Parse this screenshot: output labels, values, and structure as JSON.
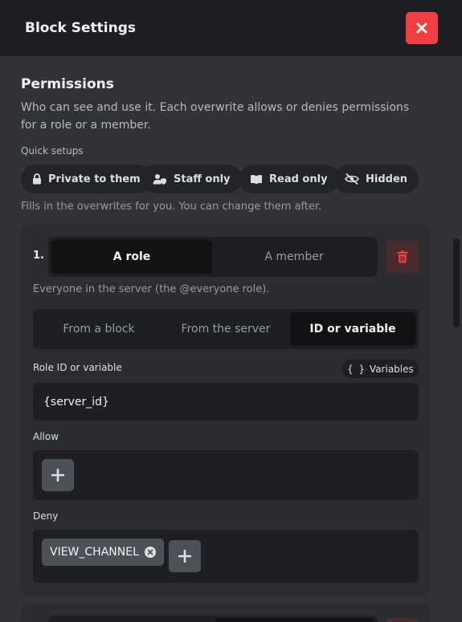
{
  "header": {
    "title": "Block Settings"
  },
  "permissions": {
    "title": "Permissions",
    "description": "Who can see and use it. Each overwrite allows or denies permissions for a role or a member.",
    "quick_setups_label": "Quick setups",
    "quick_setups": [
      {
        "label": "Private to them",
        "icon": "lock-icon"
      },
      {
        "label": "Staff only",
        "icon": "user-shield-icon"
      },
      {
        "label": "Read only",
        "icon": "book-icon"
      },
      {
        "label": "Hidden",
        "icon": "eye-off-icon"
      }
    ],
    "hint": "Fills in the overwrites for you. You can change them after."
  },
  "overwrite": {
    "number": "1.",
    "target_options": [
      "A role",
      "A member"
    ],
    "target_selected": "A role",
    "target_description": "Everyone in the server (the @everyone role).",
    "source_options": [
      "From a block",
      "From the server",
      "ID or variable"
    ],
    "source_selected": "ID or variable",
    "role_id_label": "Role ID or variable",
    "variables_button": "Variables",
    "role_id_value": "{server_id}",
    "allow_label": "Allow",
    "allow": [],
    "deny_label": "Deny",
    "deny": [
      "VIEW_CHANNEL"
    ]
  },
  "colors": {
    "background": "#313338",
    "header": "#1e1f22",
    "danger": "#f23f43",
    "danger_muted": "#4a2b2e",
    "input": "#1e1f22"
  }
}
